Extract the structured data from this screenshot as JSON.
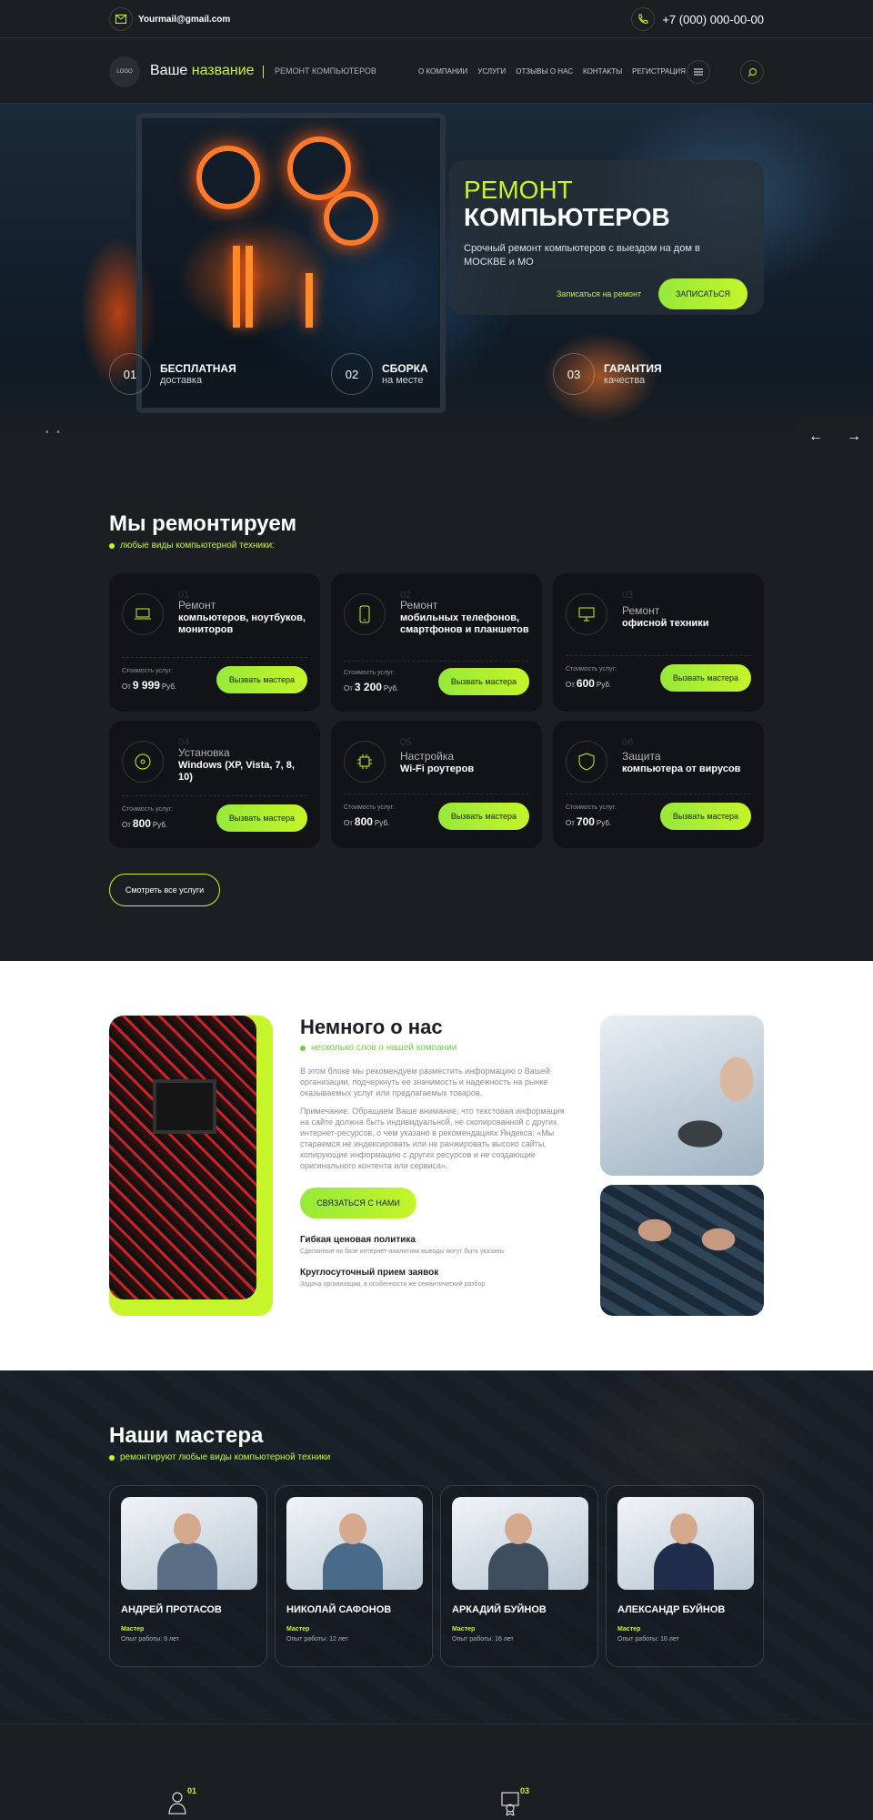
{
  "topbar": {
    "email": "Yourmail@gmail.com",
    "phone": "+7 (000) 000-00-00"
  },
  "header": {
    "logo": "LOGO",
    "brand_plain": "Ваше ",
    "brand_accent": "название",
    "brand_sub": "РЕМОНТ КОМПЬЮТЕРОВ",
    "nav": [
      "О КОМПАНИИ",
      "УСЛУГИ",
      "ОТЗЫВЫ О НАС",
      "КОНТАКТЫ",
      "РЕГИСТРАЦИЯ"
    ]
  },
  "hero": {
    "title_1": "РЕМОНТ",
    "title_2": "КОМПЬЮТЕРОВ",
    "text": "Срочный ремонт компьютеров с выездом на дом в МОСКВЕ и МО",
    "signup_link": "Записаться на ремонт",
    "cta": "ЗАПИСАТЬСЯ",
    "features": [
      {
        "num": "01",
        "title": "БЕСПЛАТНАЯ",
        "sub": "доставка"
      },
      {
        "num": "02",
        "title": "СБОРКА",
        "sub": "на месте"
      },
      {
        "num": "03",
        "title": "ГАРАНТИЯ",
        "sub": "качества"
      }
    ],
    "dots": "• •",
    "arrow_prev": "←",
    "arrow_next": "→"
  },
  "services": {
    "title": "Мы ремонтируем",
    "subtitle": "любые виды компьютерной техники:",
    "price_label": "Стоимость услуг:",
    "from": "От",
    "currency": "Руб.",
    "call_label": "Вызвать мастера",
    "items": [
      {
        "num": "01",
        "line1": "Ремонт",
        "line2": "компьютеров, ноутбуков, мониторов",
        "price": "9 999",
        "icon": "laptop-icon"
      },
      {
        "num": "02",
        "line1": "Ремонт",
        "line2": "мобильных телефонов, смартфонов и планшетов",
        "price": "3 200",
        "icon": "phone-icon"
      },
      {
        "num": "03",
        "line1": "Ремонт",
        "line2": "офисной техники",
        "price": "600",
        "icon": "monitor-icon"
      },
      {
        "num": "04",
        "line1": "Установка",
        "line2": "Windows (XP, Vista, 7, 8, 10)",
        "price": "800",
        "icon": "disc-icon"
      },
      {
        "num": "05",
        "line1": "Настройка",
        "line2": "Wi-Fi роутеров",
        "price": "800",
        "icon": "chip-icon"
      },
      {
        "num": "06",
        "line1": "Защита",
        "line2": "компьютера от вирусов",
        "price": "700",
        "icon": "shield-icon"
      }
    ],
    "all_button": "Смотреть все услуги"
  },
  "about": {
    "title": "Немного о нас",
    "subtitle": "несколько слов о нашей компании",
    "p1": "В этом блоке мы рекомендуем разместить информацию о Вашей организации, подчеркнуть ее значимость и надежность на рынке оказываемых услуг или предлагаемых товаров.",
    "p2": "Примечание. Обращаем Ваше внимание, что текстовая информация на сайте должна быть индивидуальной, не скопированной с других интернет-ресурсов, о чем указано в рекомендациях Яндекса: «Мы стараемся не индексировать или не ранжировать высоко сайты, копирующие информацию с других ресурсов и не создающие оригинального контента или сервиса».",
    "contact_button": "СВЯЗАТЬСЯ С НАМИ",
    "features": [
      {
        "title": "Гибкая ценовая политика",
        "text": "Сделанные на базе интернет-аналитики выводы могут быть указаны"
      },
      {
        "title": "Круглосуточный прием заявок",
        "text": "Задача организации, в особенности же семантический разбор"
      }
    ]
  },
  "masters": {
    "title": "Наши мастера",
    "subtitle": "ремонтируют любые виды компьютерной техники",
    "role": "Мастер",
    "items": [
      {
        "name": "АНДРЕЙ ПРОТАСОВ",
        "exp": "Опыт работы: 8 лет"
      },
      {
        "name": "НИКОЛАЙ САФОНОВ",
        "exp": "Опыт работы: 12 лет"
      },
      {
        "name": "АРКАДИЙ БУЙНОВ",
        "exp": "Опыт работы: 16 лет"
      },
      {
        "name": "АЛЕКСАНДР БУЙНОВ",
        "exp": "Опыт работы: 16 лет"
      }
    ]
  },
  "advantages": [
    {
      "num": "01",
      "icon": "worker-icon"
    },
    {
      "num": "03",
      "icon": "certificate-icon"
    }
  ],
  "colors": {
    "accent": "#c5f52a",
    "dark": "#1c1f22",
    "card": "#111316"
  }
}
